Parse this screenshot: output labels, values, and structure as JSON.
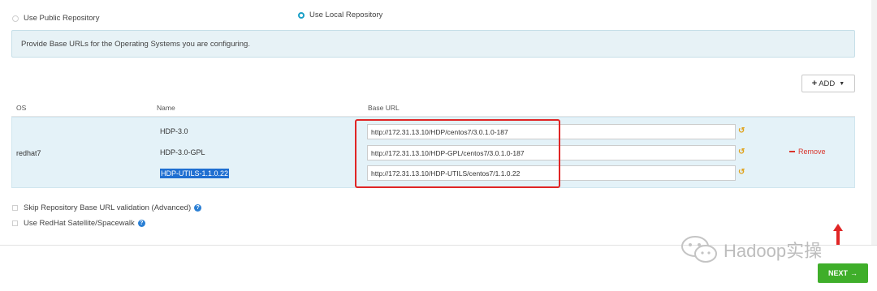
{
  "repository_type": {
    "public_label": "Use Public Repository",
    "local_label": "Use Local Repository",
    "selected": "local"
  },
  "info_message": "Provide Base URLs for the Operating Systems you are configuring.",
  "add_button": {
    "icon": "plus-icon",
    "label": "ADD"
  },
  "table": {
    "headers": {
      "os": "OS",
      "name": "Name",
      "base_url": "Base URL"
    },
    "os_group": {
      "os": "redhat7",
      "repos": [
        {
          "name": "HDP-3.0",
          "base_url": "http://172.31.13.10/HDP/centos7/3.0.1.0-187"
        },
        {
          "name": "HDP-3.0-GPL",
          "base_url": "http://172.31.13.10/HDP-GPL/centos7/3.0.1.0-187"
        },
        {
          "name": "HDP-UTILS-1.1.0.22",
          "base_url": "http://172.31.13.10/HDP-UTILS/centos7/1.1.0.22"
        }
      ],
      "undo_icon": "undo-icon",
      "remove_label": "Remove"
    }
  },
  "options": {
    "skip_validation_label": "Skip Repository Base URL validation (Advanced)",
    "redhat_satellite_label": "Use RedHat Satellite/Spacewalk"
  },
  "watermark_text": "Hadoop实操",
  "next_button": {
    "label": "NEXT",
    "icon": "arrow-right-icon"
  },
  "colors": {
    "accent": "#1a9fc7",
    "info_bg": "#e7f2f6",
    "row_bg": "#e4f2f8",
    "remove": "#d9342b",
    "next": "#3fae2a",
    "annotation": "#e02525",
    "undo": "#e0a21b"
  }
}
